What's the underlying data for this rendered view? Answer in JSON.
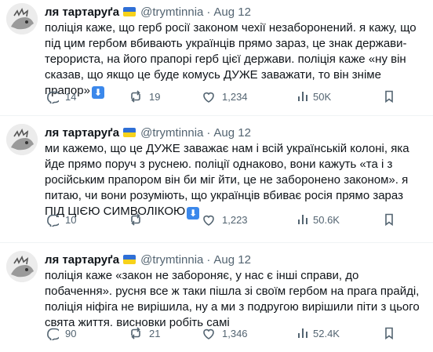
{
  "colors": {
    "flag_blue": "#2f6fd6",
    "flag_yellow": "#f7d21b",
    "muted": "#536471",
    "text": "#0f1419"
  },
  "icons": [
    "reply-icon",
    "retweet-icon",
    "like-icon",
    "views-icon",
    "bookmark-icon",
    "download-emoji-icon",
    "ukraine-flag-emoji"
  ],
  "tweets": [
    {
      "name": "ля тартаруґа",
      "handle": "@trymtinnia",
      "dot": "·",
      "date": "Aug 12",
      "text": "поліція каже, що герб росії законом чехії незаборонений. я кажу, що під цим гербом вбивають українців прямо зараз, це знак держави-терориста, на його прапорі герб цієї держави. поліція каже «ну він сказав, що якщо це буде комусь ДУЖЕ заважати, то він зніме прапор»",
      "replies": "14",
      "retweets": "19",
      "likes": "1,234",
      "views": "50K"
    },
    {
      "name": "ля тартаруґа",
      "handle": "@trymtinnia",
      "dot": "·",
      "date": "Aug 12",
      "text": "ми кажемо, що це ДУЖЕ заважає нам і всій українській колоні, яка йде прямо поруч з руснею. поліції однаково, вони кажуть «та і з російським прапором він би міг йти, це не заборонено законом». я питаю, чи вони розуміють, що українців вбиває росія прямо зараз ПІД ЦІЄЮ СИМВОЛІКОЮ",
      "replies": "10",
      "retweets": "",
      "likes": "1,223",
      "views": "50.6K"
    },
    {
      "name": "ля тартаруґа",
      "handle": "@trymtinnia",
      "dot": "·",
      "date": "Aug 12",
      "text": "поліція каже «закон не забороняє, у нас є інші справи, до побачення». русня все ж таки пішла зі своїм гербом на прага прайді, поліція ніфіга не вирішила, ну а ми з подругою вирішили піти з цього свята життя. висновки робіть самі",
      "replies": "90",
      "retweets": "21",
      "likes": "1,346",
      "views": "52.4K"
    }
  ]
}
